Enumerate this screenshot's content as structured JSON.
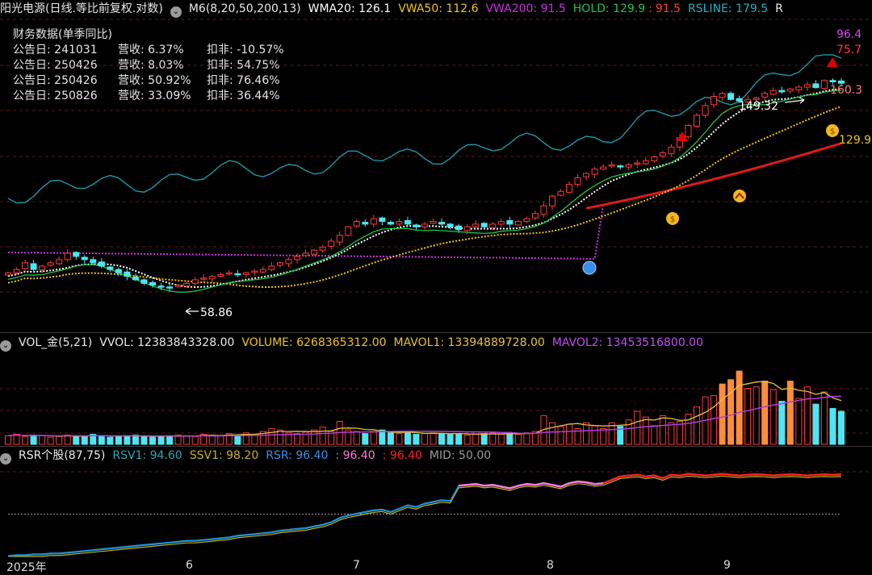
{
  "main_header": {
    "stock": "阳光电源(日线.等比前复权.对数)",
    "m6": "M6(8,20,50,200,13)",
    "wma20": "WMA20: 126.1",
    "vwa50": "VWA50: 112.6",
    "vwa200": "VWA200: 91.5",
    "hold": "HOLD: 129.9",
    "hold_sep": ":",
    "hold2": "91.5",
    "rsline": "RSLINE: 179.5",
    "tail": "R"
  },
  "finance": {
    "title": "财务数据(单季同比)",
    "rows": [
      {
        "date": "公告日: 241031",
        "rev": "营收:  6.37%",
        "net": "扣非:  -10.57%"
      },
      {
        "date": "公告日: 250426",
        "rev": "营收:  8.03%",
        "net": "扣非:  54.75%"
      },
      {
        "date": "公告日: 250426",
        "rev": "营收:  50.92%",
        "net": "扣非:  76.46%"
      },
      {
        "date": "公告日: 250826",
        "rev": "营收:  33.09%",
        "net": "扣非:  36.44%"
      }
    ]
  },
  "labels": {
    "rs_top1": "96.4",
    "rs_top2": "75.7",
    "price_high": "160.3",
    "price_mark": "149.32",
    "price_low": "58.86",
    "hold_right": "129.9"
  },
  "vol_header": {
    "name": "VOL_金(5,21)",
    "vvol": "VVOL: 12383843328.00",
    "volume": "VOLUME: 6268365312.00",
    "mavol1": "MAVOL1: 13394889728.00",
    "mavol2": "MAVOL2: 13453516800.00"
  },
  "rsr_header": {
    "name": "RSR个股(87,75)",
    "rsv1": "RSV1: 94.60",
    "ssv1": "SSV1: 98.20",
    "rsr": "RSR: 96.40",
    "v1": ": 96.40",
    "v2": ": 96.40",
    "mid": "MID: 50.00"
  },
  "xaxis": [
    "2025年",
    "6",
    "7",
    "8",
    "9"
  ],
  "colors": {
    "up": "#ff3b3b",
    "down": "#4ee6f2",
    "wma20": "#ffffff",
    "vwa50": "#f0c419",
    "vwa200": "#cc2ee0",
    "hold": "#21c24a",
    "rsline": "#1f8ea0",
    "vwa200_low": "#e01a1a",
    "mavol1": "#e8c23a",
    "mavol2": "#b13ee0",
    "rsv1": "#2a8fb0",
    "ssv1": "#c9b31f",
    "rsr": "#1aa0ff",
    "pink": "#ff7ad9",
    "red": "#ff2020",
    "mid": "#9a9a9a"
  },
  "chart_data": [
    {
      "type": "candlestick",
      "title": "阳光电源(日线.等比前复权.对数)",
      "scale": "log",
      "x_labels": [
        "2025年",
        "6",
        "7",
        "8",
        "9"
      ],
      "series": [
        {
          "name": "WMA20",
          "last": 126.1
        },
        {
          "name": "VWA50",
          "last": 112.6
        },
        {
          "name": "VWA200",
          "last": 91.5
        },
        {
          "name": "HOLD",
          "last": 129.9
        },
        {
          "name": "RSLINE",
          "last": 179.5
        }
      ],
      "annotations": {
        "high": 160.3,
        "marked": 149.32,
        "low": 58.86
      },
      "close": [
        63,
        64,
        66,
        64,
        65,
        66,
        67,
        69,
        68,
        67,
        66,
        65,
        64,
        63,
        62,
        61,
        60,
        59.5,
        59,
        58.9,
        59.5,
        60,
        61,
        61.5,
        62,
        62.5,
        63,
        62.5,
        63,
        63.5,
        64,
        65,
        66,
        67,
        68,
        69,
        70,
        71,
        73,
        75,
        78,
        80,
        79,
        81,
        80,
        79,
        80,
        79,
        78,
        79,
        80,
        79,
        78,
        77,
        78,
        79,
        78,
        79,
        80,
        79,
        80,
        81,
        83,
        86,
        90,
        92,
        95,
        98,
        100,
        102,
        103,
        104,
        103,
        104,
        105,
        106,
        108,
        110,
        113,
        118,
        125,
        131,
        137,
        143,
        145,
        141,
        140,
        141,
        142,
        145,
        147,
        146,
        148,
        149.32,
        151,
        149,
        154,
        153,
        152
      ]
    },
    {
      "type": "bar",
      "title": "VOL_金(5,21)",
      "series": [
        {
          "name": "VVOL",
          "last": 12383843328.0
        },
        {
          "name": "VOLUME",
          "last": 6268365312.0
        },
        {
          "name": "MAVOL1",
          "last": 13394889728.0
        },
        {
          "name": "MAVOL2",
          "last": 13453516800.0
        }
      ],
      "values": [
        1.2,
        1.4,
        1.1,
        1.3,
        1.2,
        1.0,
        1.1,
        1.3,
        1.2,
        1.1,
        1.4,
        1.2,
        1.0,
        1.1,
        1.2,
        1.3,
        1.1,
        1.0,
        1.1,
        1.2,
        1.3,
        1.2,
        1.1,
        1.4,
        1.3,
        1.2,
        1.5,
        1.3,
        1.6,
        1.4,
        1.8,
        2.2,
        2.0,
        1.6,
        1.5,
        1.7,
        2.0,
        2.4,
        1.8,
        3.2,
        2.0,
        1.8,
        1.5,
        1.7,
        2.0,
        1.6,
        1.5,
        1.7,
        1.4,
        1.5,
        1.6,
        1.5,
        1.4,
        1.5,
        1.3,
        1.4,
        1.5,
        1.6,
        1.4,
        1.5,
        1.4,
        1.6,
        1.8,
        4.0,
        3.0,
        2.5,
        2.8,
        2.2,
        3.0,
        2.6,
        2.2,
        3.0,
        2.5,
        3.4,
        4.6,
        3.8,
        2.6,
        4.0,
        3.0,
        3.2,
        4.2,
        5.2,
        6.6,
        6.8,
        8.4,
        9.0,
        10.2,
        7.8,
        8.0,
        8.8,
        7.6,
        6.0,
        8.8,
        6.4,
        8.0,
        5.6,
        7.3,
        5.0,
        4.6
      ]
    },
    {
      "type": "line",
      "title": "RSR个股(87,75)",
      "ylim": [
        0,
        100
      ],
      "series": [
        {
          "name": "RSV1",
          "last": 94.6
        },
        {
          "name": "SSV1",
          "last": 98.2
        },
        {
          "name": "RSR",
          "last": 96.4
        },
        {
          "name": "MID",
          "last": 50.0
        }
      ],
      "values": [
        0,
        1,
        1,
        2,
        2,
        3,
        3,
        4,
        5,
        6,
        7,
        8,
        9,
        10,
        11,
        12,
        13,
        14,
        15,
        16,
        17,
        18,
        18,
        19,
        20,
        21,
        22,
        24,
        25,
        26,
        27,
        28,
        30,
        31,
        32,
        33,
        35,
        37,
        40,
        45,
        48,
        50,
        52,
        54,
        55,
        52,
        56,
        60,
        58,
        62,
        64,
        66,
        65,
        83,
        84,
        85,
        83,
        84,
        82,
        80,
        83,
        85,
        84,
        86,
        84,
        82,
        86,
        88,
        87,
        85,
        86,
        90,
        94,
        95,
        96,
        94,
        95,
        92,
        96,
        95,
        97,
        96,
        95,
        96,
        97,
        96,
        95,
        96,
        96.4,
        96,
        95,
        96,
        96.4,
        96,
        95,
        96,
        96.4,
        96,
        96.4
      ]
    }
  ]
}
